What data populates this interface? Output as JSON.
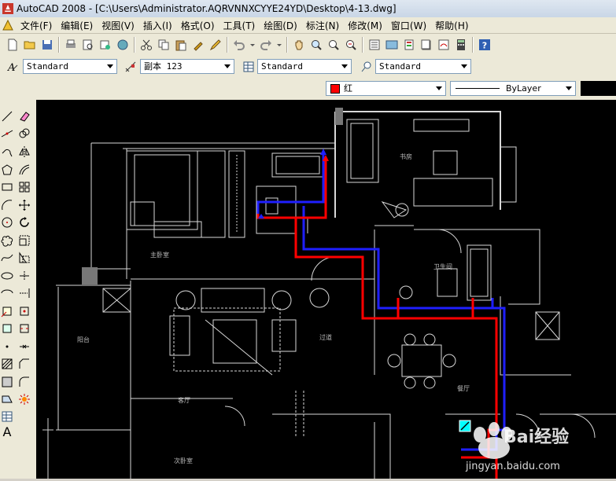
{
  "window": {
    "title": "AutoCAD 2008 - [C:\\Users\\Administrator.AQRVNNXCYYE24YD\\Desktop\\4-13.dwg]"
  },
  "menu": [
    "文件(F)",
    "编辑(E)",
    "视图(V)",
    "插入(I)",
    "格式(O)",
    "工具(T)",
    "绘图(D)",
    "标注(N)",
    "修改(M)",
    "窗口(W)",
    "帮助(H)"
  ],
  "styles": {
    "text_style": "Standard",
    "dim_style": "副本 123",
    "table_style": "Standard",
    "multileader_style": "Standard"
  },
  "properties": {
    "color": "红",
    "color_hex": "#ff0000",
    "linetype": "ByLayer"
  },
  "drawing": {
    "room_labels": [
      "书房",
      "主卧室",
      "卫生间",
      "阳台",
      "客厅",
      "过道",
      "餐厅",
      "次卧室"
    ],
    "pipe_colors": {
      "hot": "#ff0000",
      "cold": "#0000ff"
    }
  },
  "watermark": {
    "brand": "Bai经验",
    "url": "jingyan.baidu.com"
  }
}
